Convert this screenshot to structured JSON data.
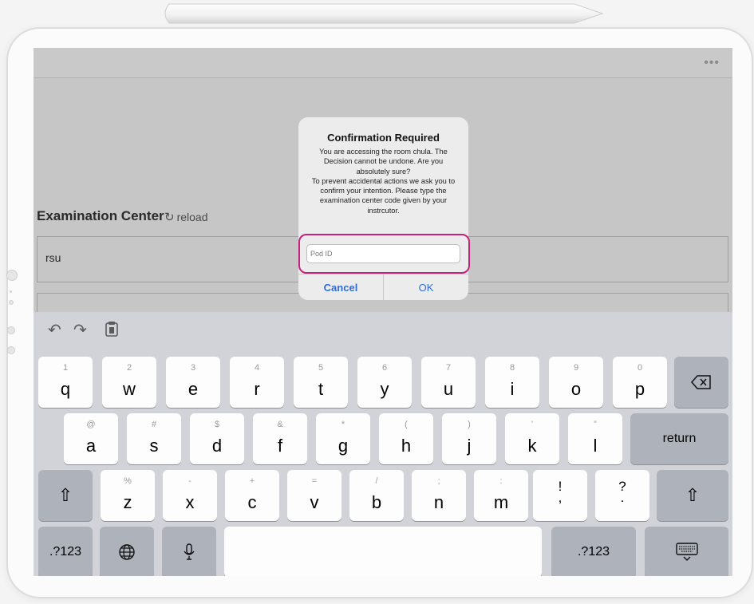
{
  "navbar": {
    "more_icon": "ellipsis-icon"
  },
  "page": {
    "section_title": "Examination Center",
    "reload_label": "reload",
    "rows": [
      "rsu",
      ""
    ]
  },
  "dialog": {
    "title": "Confirmation Required",
    "message": "You are accessing the room chula. The Decision cannot be undone. Are you absolutely sure?\nTo prevent accidental actions we ask you to confirm your intention. Please type the examination center code given  by your instrcutor.",
    "input_placeholder": "Pod ID",
    "input_value": "",
    "cancel_label": "Cancel",
    "ok_label": "OK"
  },
  "keyboard": {
    "toolbar_icons": [
      "undo-icon",
      "redo-icon",
      "paste-icon"
    ],
    "row1": [
      {
        "main": "q",
        "sub": "1"
      },
      {
        "main": "w",
        "sub": "2"
      },
      {
        "main": "e",
        "sub": "3"
      },
      {
        "main": "r",
        "sub": "4"
      },
      {
        "main": "t",
        "sub": "5"
      },
      {
        "main": "y",
        "sub": "6"
      },
      {
        "main": "u",
        "sub": "7"
      },
      {
        "main": "i",
        "sub": "8"
      },
      {
        "main": "o",
        "sub": "9"
      },
      {
        "main": "p",
        "sub": "0"
      }
    ],
    "row2": [
      {
        "main": "a",
        "sub": "@"
      },
      {
        "main": "s",
        "sub": "#"
      },
      {
        "main": "d",
        "sub": "$"
      },
      {
        "main": "f",
        "sub": "&"
      },
      {
        "main": "g",
        "sub": "*"
      },
      {
        "main": "h",
        "sub": "("
      },
      {
        "main": "j",
        "sub": ")"
      },
      {
        "main": "k",
        "sub": "’"
      },
      {
        "main": "l",
        "sub": "”"
      }
    ],
    "row3": [
      {
        "main": "z",
        "sub": "%"
      },
      {
        "main": "x",
        "sub": "-"
      },
      {
        "main": "c",
        "sub": "+"
      },
      {
        "main": "v",
        "sub": "="
      },
      {
        "main": "b",
        "sub": "/"
      },
      {
        "main": "n",
        "sub": ";"
      },
      {
        "main": "m",
        "sub": ":"
      }
    ],
    "punct_keys": [
      {
        "top": "!",
        "bottom": ","
      },
      {
        "top": "?",
        "bottom": "."
      }
    ],
    "return_label": "return",
    "numbers_label": ".?123",
    "colors": {
      "background": "#d2d3d8",
      "key": "#fdfdfd",
      "dark_key": "#aeb2ba"
    }
  },
  "colors": {
    "accent": "#2f6ed8",
    "focus_ring": "#c4237c"
  }
}
